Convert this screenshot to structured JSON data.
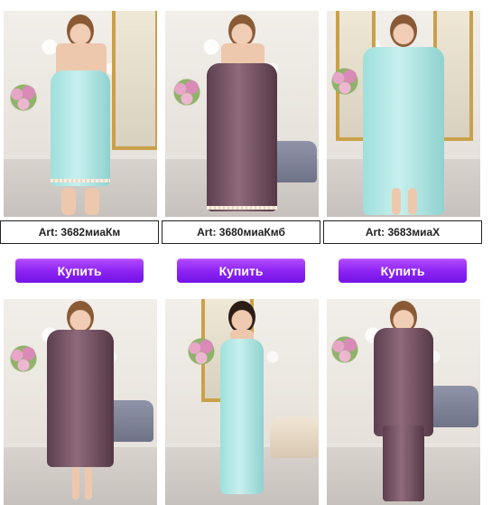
{
  "products": [
    {
      "article": "Art: 3682миаКм",
      "buy_label": "Купить",
      "image_alt": "",
      "color": "#b7ecea"
    },
    {
      "article": "Art: 3680миаКмб",
      "buy_label": "Купить",
      "image_alt": "",
      "color": "#6f4d5e"
    },
    {
      "article": "Art: 3683миаХ",
      "buy_label": "Купить",
      "image_alt": "",
      "color": "#b7ecea"
    },
    {
      "color": "#6f4d5e"
    },
    {
      "color": "#b7ecea"
    },
    {
      "color": "#6f4d5e"
    }
  ],
  "colors": {
    "button_accent": "#8b22f2",
    "mint": "#b7ecea",
    "plum": "#6f4d5e"
  }
}
